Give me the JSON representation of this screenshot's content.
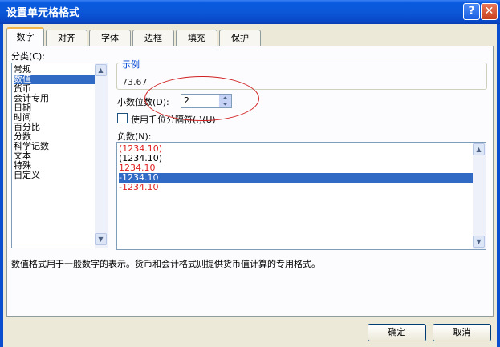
{
  "window": {
    "title": "设置单元格格式"
  },
  "tabs": [
    "数字",
    "对齐",
    "字体",
    "边框",
    "填充",
    "保护"
  ],
  "active_tab": "数字",
  "category": {
    "label": "分类(C):",
    "items": [
      "常规",
      "数值",
      "货币",
      "会计专用",
      "日期",
      "时间",
      "百分比",
      "分数",
      "科学记数",
      "文本",
      "特殊",
      "自定义"
    ],
    "selected": "数值"
  },
  "sample": {
    "label": "示例",
    "value": "73.67"
  },
  "decimals": {
    "label": "小数位数(D):",
    "value": "2"
  },
  "thousands_separator": {
    "label": "使用千位分隔符(,)(U)",
    "checked": false
  },
  "negative_numbers": {
    "label": "负数(N):",
    "items": [
      {
        "text": "(1234.10)",
        "color": "#e02020"
      },
      {
        "text": "(1234.10)",
        "color": "#000000"
      },
      {
        "text": "1234.10",
        "color": "#e02020"
      },
      {
        "text": "-1234.10",
        "color": "#000000"
      },
      {
        "text": "-1234.10",
        "color": "#e02020"
      }
    ],
    "selected_index": 3
  },
  "description": "数值格式用于一般数字的表示。货币和会计格式则提供货币值计算的专用格式。",
  "buttons": {
    "ok": "确定",
    "cancel": "取消"
  },
  "title_buttons": {
    "help": "?",
    "close": "✕"
  },
  "scroll_arrows": {
    "up": "▲",
    "down": "▼"
  }
}
